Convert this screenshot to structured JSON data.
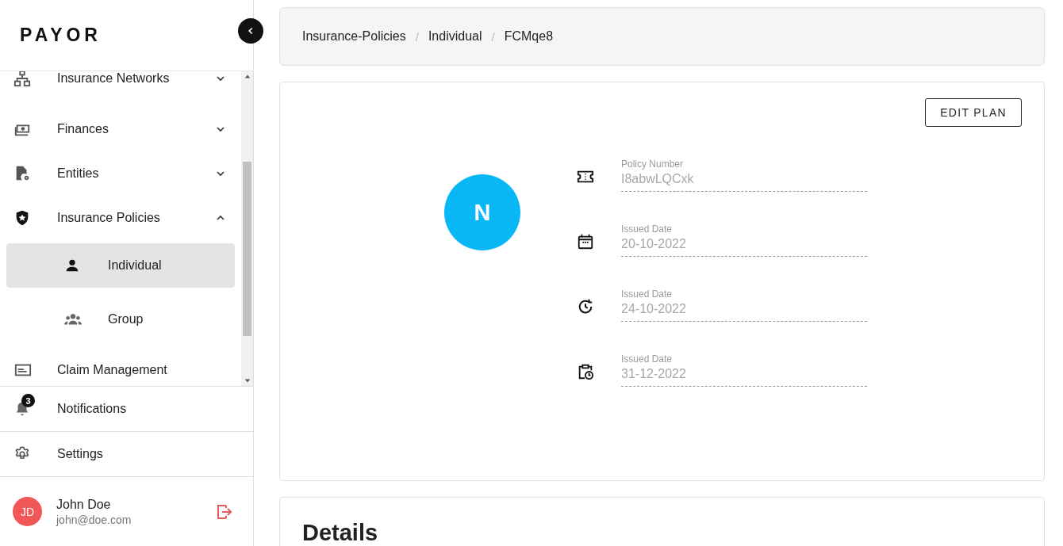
{
  "sidebar": {
    "logo": "PAYOR",
    "nav": [
      {
        "label": "Insurance Networks",
        "kind": "network",
        "expanded": false
      },
      {
        "label": "Finances",
        "kind": "money",
        "expanded": false
      },
      {
        "label": "Entities",
        "kind": "file-gear",
        "expanded": false
      },
      {
        "label": "Insurance Policies",
        "kind": "shield",
        "expanded": true,
        "children": [
          {
            "label": "Individual",
            "kind": "person",
            "selected": true
          },
          {
            "label": "Group",
            "kind": "people",
            "selected": false
          }
        ]
      },
      {
        "label": "Claim Management",
        "kind": "card"
      }
    ],
    "footer": [
      {
        "label": "Notifications",
        "kind": "bell",
        "badge": "3"
      },
      {
        "label": "Settings",
        "kind": "gear"
      }
    ],
    "user": {
      "initials": "JD",
      "name": "John Doe",
      "email": "john@doe.com"
    }
  },
  "breadcrumb": {
    "separator": "/",
    "items": [
      "Insurance-Policies",
      "Individual",
      "FCMqe8"
    ]
  },
  "policy": {
    "avatar": "N",
    "edit_button": "EDIT PLAN",
    "fields": [
      {
        "kind": "ticket",
        "label": "Policy Number",
        "value": "I8abwLQCxk"
      },
      {
        "kind": "calendar",
        "label": "Issued Date",
        "value": "20-10-2022"
      },
      {
        "kind": "clock",
        "label": "Issued Date",
        "value": "24-10-2022"
      },
      {
        "kind": "clipboard-clock",
        "label": "Issued Date",
        "value": "31-12-2022"
      }
    ]
  },
  "details": {
    "title": "Details"
  }
}
